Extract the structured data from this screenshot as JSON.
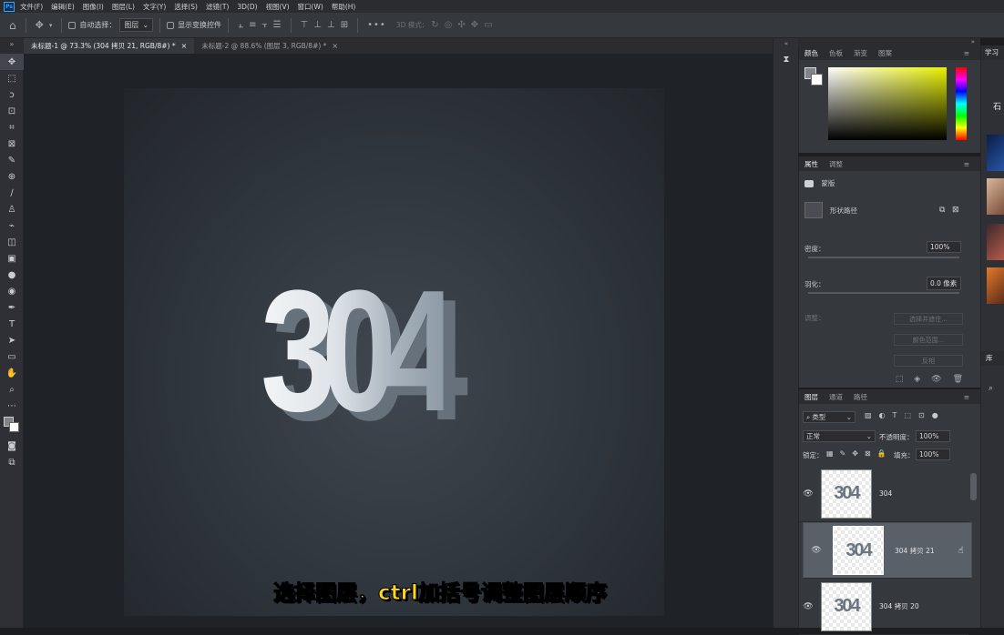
{
  "menubar": {
    "logo": "Ps",
    "items": [
      "文件(F)",
      "编辑(E)",
      "图像(I)",
      "图层(L)",
      "文字(Y)",
      "选择(S)",
      "滤镜(T)",
      "3D(D)",
      "视图(V)",
      "窗口(W)",
      "帮助(H)"
    ]
  },
  "options": {
    "auto_select_label": "自动选择：",
    "auto_select_value": "图层",
    "show_transform_label": "显示变换控件",
    "mode_3d_label": "3D 模式："
  },
  "tabs": [
    {
      "label": "未标题-1 @ 73.3% (304 拷贝 21, RGB/8#) *",
      "close": "×"
    },
    {
      "label": "未标题-2 @ 88.6% (图层 3, RGB/8#) *",
      "close": "×"
    }
  ],
  "artwork": {
    "text": "304"
  },
  "subtitle": "选择图层，ctrl加括号调整图层顺序",
  "color_panel": {
    "tabs": [
      "颜色",
      "色板",
      "渐变",
      "图案"
    ]
  },
  "properties_panel": {
    "tabs": [
      "属性",
      "调整"
    ],
    "mask_label": "蒙版",
    "shape_path_label": "形状路径",
    "density_label": "密度：",
    "density_value": "100%",
    "feather_label": "羽化：",
    "feather_value": "0.0 像素",
    "adjust_label": "调整：",
    "select_subject_btn": "选择并遮住...",
    "color_range_btn": "颜色范围...",
    "invert_btn": "反相"
  },
  "layers_panel": {
    "tabs": [
      "图层",
      "通道",
      "路径"
    ],
    "filter_value": "类型",
    "blend_mode": "正常",
    "opacity_label": "不透明度：",
    "opacity_value": "100%",
    "lock_label": "锁定：",
    "fill_label": "填充：",
    "fill_value": "100%",
    "layers": [
      {
        "name": "304",
        "thumb_text": "304",
        "selected": false
      },
      {
        "name": "304 拷贝 21",
        "thumb_text": "304",
        "selected": true
      },
      {
        "name": "304 拷贝 20",
        "thumb_text": "304",
        "selected": false
      }
    ]
  },
  "learn_panel": {
    "tab": "学习",
    "library_tab": "库",
    "heading_char": "石"
  },
  "icons": {
    "home": "home-icon",
    "move": "move-tool-icon",
    "eye": "eye-icon"
  }
}
